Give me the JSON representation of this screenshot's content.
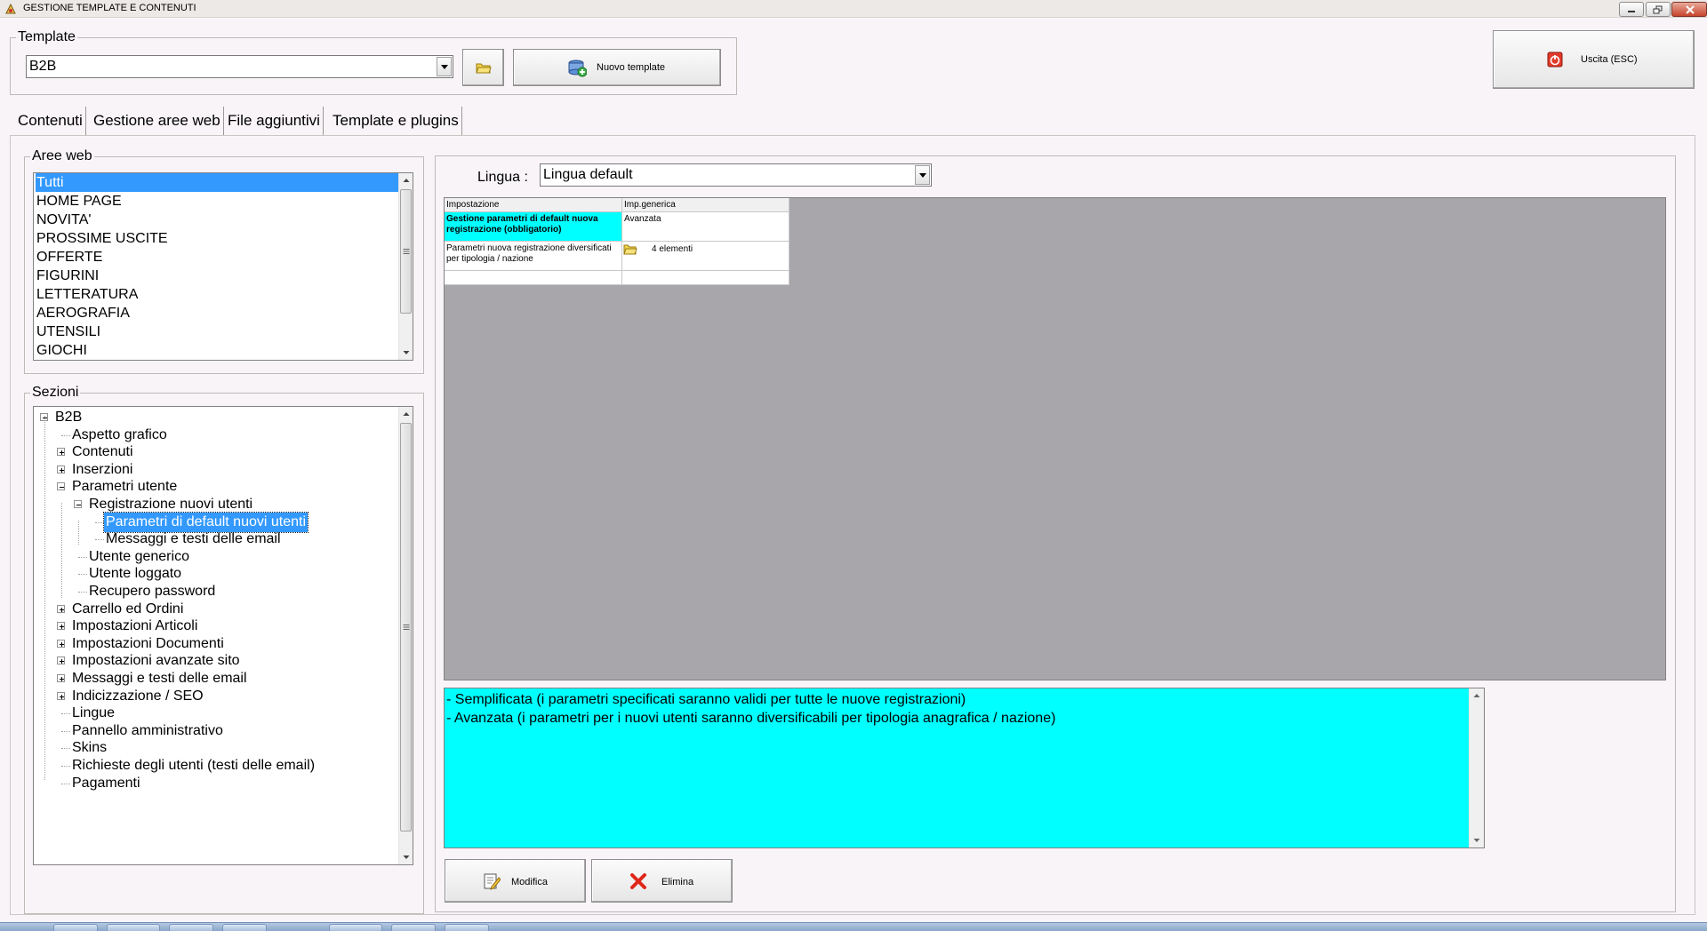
{
  "window": {
    "title": "GESTIONE TEMPLATE E CONTENUTI"
  },
  "template_group": {
    "legend": "Template",
    "combo_value": "B2B",
    "new_button_label": "Nuovo template"
  },
  "exit_button_label": "Uscita (ESC)",
  "tabs": [
    {
      "label": "Contenuti"
    },
    {
      "label": "Gestione aree web"
    },
    {
      "label": "File aggiuntivi"
    },
    {
      "label": "Template e plugins"
    }
  ],
  "aree_web": {
    "legend": "Aree web",
    "items": [
      "Tutti",
      "HOME PAGE",
      "NOVITA'",
      "PROSSIME USCITE",
      "OFFERTE",
      "FIGURINI",
      "LETTERATURA",
      "AEROGRAFIA",
      "UTENSILI",
      "GIOCHI"
    ],
    "selected": "Tutti"
  },
  "sezioni": {
    "legend": "Sezioni",
    "tree": [
      {
        "label": "B2B",
        "state": "collapse"
      },
      {
        "label": "Aspetto grafico",
        "state": "leaf"
      },
      {
        "label": "Contenuti",
        "state": "expand"
      },
      {
        "label": "Inserzioni",
        "state": "expand"
      },
      {
        "label": "Parametri utente",
        "state": "collapse"
      },
      {
        "label": "Registrazione nuovi utenti",
        "state": "collapse"
      },
      {
        "label": "Parametri di default nuovi utenti",
        "state": "leaf",
        "selected": true
      },
      {
        "label": "Messaggi e testi delle email",
        "state": "leaf"
      },
      {
        "label": "Utente generico",
        "state": "leaf"
      },
      {
        "label": "Utente loggato",
        "state": "leaf"
      },
      {
        "label": "Recupero password",
        "state": "leaf"
      },
      {
        "label": "Carrello ed Ordini",
        "state": "expand"
      },
      {
        "label": "Impostazioni Articoli",
        "state": "expand"
      },
      {
        "label": "Impostazioni Documenti",
        "state": "expand"
      },
      {
        "label": "Impostazioni avanzate sito",
        "state": "expand"
      },
      {
        "label": "Messaggi e testi delle email",
        "state": "expand"
      },
      {
        "label": "Indicizzazione / SEO",
        "state": "expand"
      },
      {
        "label": "Lingue",
        "state": "leaf"
      },
      {
        "label": "Pannello amministrativo",
        "state": "leaf"
      },
      {
        "label": "Skins",
        "state": "leaf"
      },
      {
        "label": "Richieste degli utenti (testi delle email)",
        "state": "leaf"
      },
      {
        "label": "Pagamenti",
        "state": "leaf"
      }
    ]
  },
  "lingua": {
    "label": "Lingua :",
    "value": "Lingua default"
  },
  "grid": {
    "headers": [
      "Impostazione",
      "Imp.generica"
    ],
    "rows": [
      {
        "setting": "Gestione parametri di default nuova registrazione (obbligatorio)",
        "value": "Avanzata"
      },
      {
        "setting": "Parametri nuova registrazione diversificati per tipologia / nazione",
        "value": "4 elementi"
      }
    ]
  },
  "description": {
    "lines": [
      "- Semplificata (i parametri specificati saranno validi per tutte le nuove registrazioni)",
      "- Avanzata (i parametri per i nuovi utenti saranno diversificabili per tipologia anagrafica / nazione)"
    ]
  },
  "actions": {
    "modify_label": "Modifica",
    "delete_label": "Elimina"
  },
  "colors": {
    "selection": "#3399ff",
    "highlight": "#00ffff",
    "grid_background": "#a8a6aa"
  }
}
